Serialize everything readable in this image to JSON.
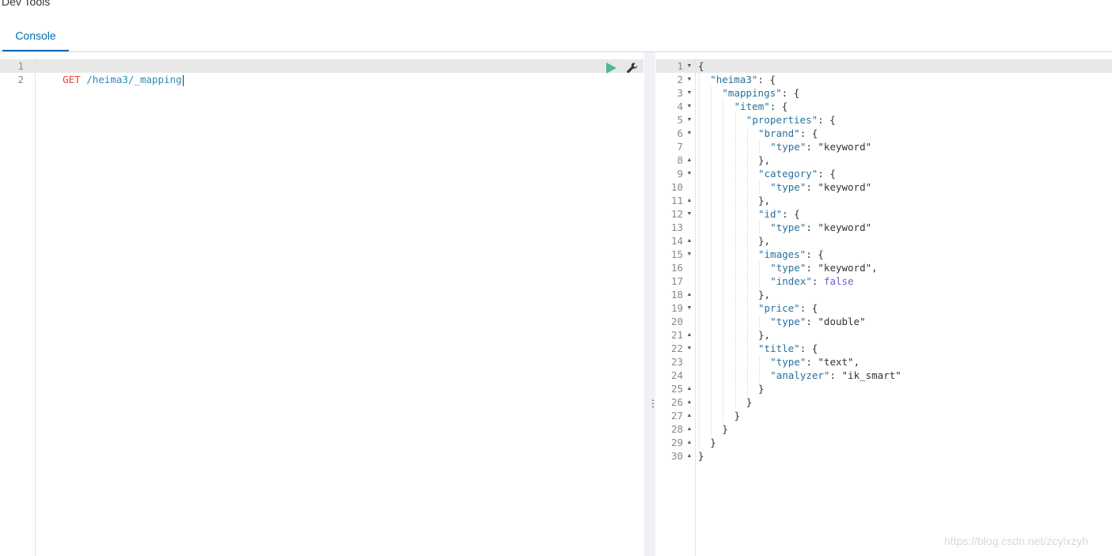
{
  "app": {
    "title": "Dev Tools"
  },
  "tabs": [
    {
      "label": "Console",
      "active": true
    }
  ],
  "request": {
    "lines": [
      {
        "num": "1",
        "method": "GET",
        "url": "/heima3/_mapping"
      },
      {
        "num": "2",
        "method": "",
        "url": ""
      }
    ],
    "actions": {
      "run_icon": "play-icon",
      "settings_icon": "wrench-icon"
    }
  },
  "response": {
    "lines": [
      {
        "num": "1",
        "fold": "open",
        "indent": 0,
        "key": "",
        "value": "",
        "text": "{"
      },
      {
        "num": "2",
        "fold": "open",
        "indent": 1,
        "key": "\"heima3\"",
        "value": "",
        "text": ": {"
      },
      {
        "num": "3",
        "fold": "open",
        "indent": 2,
        "key": "\"mappings\"",
        "value": "",
        "text": ": {"
      },
      {
        "num": "4",
        "fold": "open",
        "indent": 3,
        "key": "\"item\"",
        "value": "",
        "text": ": {"
      },
      {
        "num": "5",
        "fold": "open",
        "indent": 4,
        "key": "\"properties\"",
        "value": "",
        "text": ": {"
      },
      {
        "num": "6",
        "fold": "open",
        "indent": 5,
        "key": "\"brand\"",
        "value": "",
        "text": ": {"
      },
      {
        "num": "7",
        "fold": "",
        "indent": 6,
        "key": "\"type\"",
        "value": "\"keyword\"",
        "text": ""
      },
      {
        "num": "8",
        "fold": "close",
        "indent": 5,
        "key": "",
        "value": "",
        "text": "},"
      },
      {
        "num": "9",
        "fold": "open",
        "indent": 5,
        "key": "\"category\"",
        "value": "",
        "text": ": {"
      },
      {
        "num": "10",
        "fold": "",
        "indent": 6,
        "key": "\"type\"",
        "value": "\"keyword\"",
        "text": ""
      },
      {
        "num": "11",
        "fold": "close",
        "indent": 5,
        "key": "",
        "value": "",
        "text": "},"
      },
      {
        "num": "12",
        "fold": "open",
        "indent": 5,
        "key": "\"id\"",
        "value": "",
        "text": ": {"
      },
      {
        "num": "13",
        "fold": "",
        "indent": 6,
        "key": "\"type\"",
        "value": "\"keyword\"",
        "text": ""
      },
      {
        "num": "14",
        "fold": "close",
        "indent": 5,
        "key": "",
        "value": "",
        "text": "},"
      },
      {
        "num": "15",
        "fold": "open",
        "indent": 5,
        "key": "\"images\"",
        "value": "",
        "text": ": {"
      },
      {
        "num": "16",
        "fold": "",
        "indent": 6,
        "key": "\"type\"",
        "value": "\"keyword\"",
        "text": ",",
        "suffix": ","
      },
      {
        "num": "17",
        "fold": "",
        "indent": 6,
        "key": "\"index\"",
        "value": "false",
        "text": "",
        "bool": true
      },
      {
        "num": "18",
        "fold": "close",
        "indent": 5,
        "key": "",
        "value": "",
        "text": "},"
      },
      {
        "num": "19",
        "fold": "open",
        "indent": 5,
        "key": "\"price\"",
        "value": "",
        "text": ": {"
      },
      {
        "num": "20",
        "fold": "",
        "indent": 6,
        "key": "\"type\"",
        "value": "\"double\"",
        "text": ""
      },
      {
        "num": "21",
        "fold": "close",
        "indent": 5,
        "key": "",
        "value": "",
        "text": "},"
      },
      {
        "num": "22",
        "fold": "open",
        "indent": 5,
        "key": "\"title\"",
        "value": "",
        "text": ": {"
      },
      {
        "num": "23",
        "fold": "",
        "indent": 6,
        "key": "\"type\"",
        "value": "\"text\"",
        "text": ",",
        "suffix": ","
      },
      {
        "num": "24",
        "fold": "",
        "indent": 6,
        "key": "\"analyzer\"",
        "value": "\"ik_smart\"",
        "text": ""
      },
      {
        "num": "25",
        "fold": "close",
        "indent": 5,
        "key": "",
        "value": "",
        "text": "}"
      },
      {
        "num": "26",
        "fold": "close",
        "indent": 4,
        "key": "",
        "value": "",
        "text": "}"
      },
      {
        "num": "27",
        "fold": "close",
        "indent": 3,
        "key": "",
        "value": "",
        "text": "}"
      },
      {
        "num": "28",
        "fold": "close",
        "indent": 2,
        "key": "",
        "value": "",
        "text": "}"
      },
      {
        "num": "29",
        "fold": "close",
        "indent": 1,
        "key": "",
        "value": "",
        "text": "}"
      },
      {
        "num": "30",
        "fold": "close",
        "indent": 0,
        "key": "",
        "value": "",
        "text": "}"
      }
    ]
  },
  "splitter": {
    "icon": "vertical-ellipsis-icon",
    "glyph": "⋮"
  },
  "watermark": "https://blog.csdn.net/zcylxzyh",
  "colors": {
    "accent": "#006bb4",
    "method": "#e5453a",
    "url": "#2d8cba",
    "key": "#28719c",
    "bool": "#6a5fd4"
  }
}
